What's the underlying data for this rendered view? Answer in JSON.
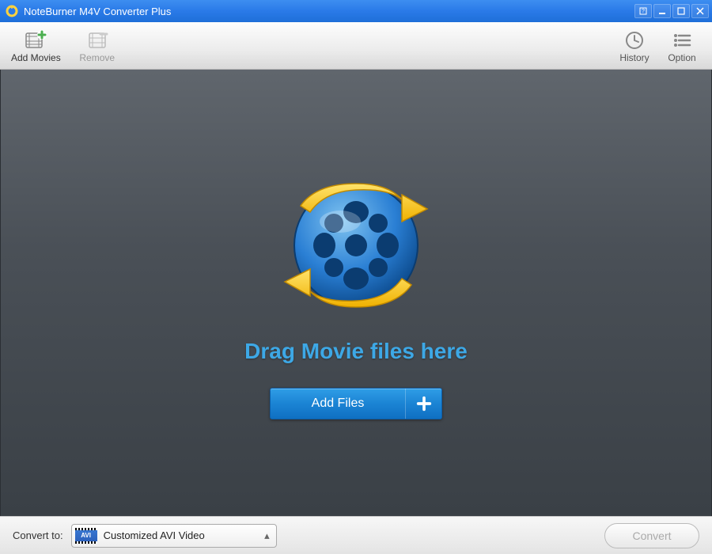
{
  "window": {
    "title": "NoteBurner M4V Converter Plus"
  },
  "toolbar": {
    "add_movies_label": "Add Movies",
    "remove_label": "Remove",
    "history_label": "History",
    "option_label": "Option"
  },
  "main": {
    "drag_text": "Drag Movie files here",
    "add_files_label": "Add Files"
  },
  "footer": {
    "convert_to_label": "Convert to:",
    "selected_format_name": "Customized AVI Video",
    "selected_format_badge": "AVI",
    "convert_button_label": "Convert"
  }
}
